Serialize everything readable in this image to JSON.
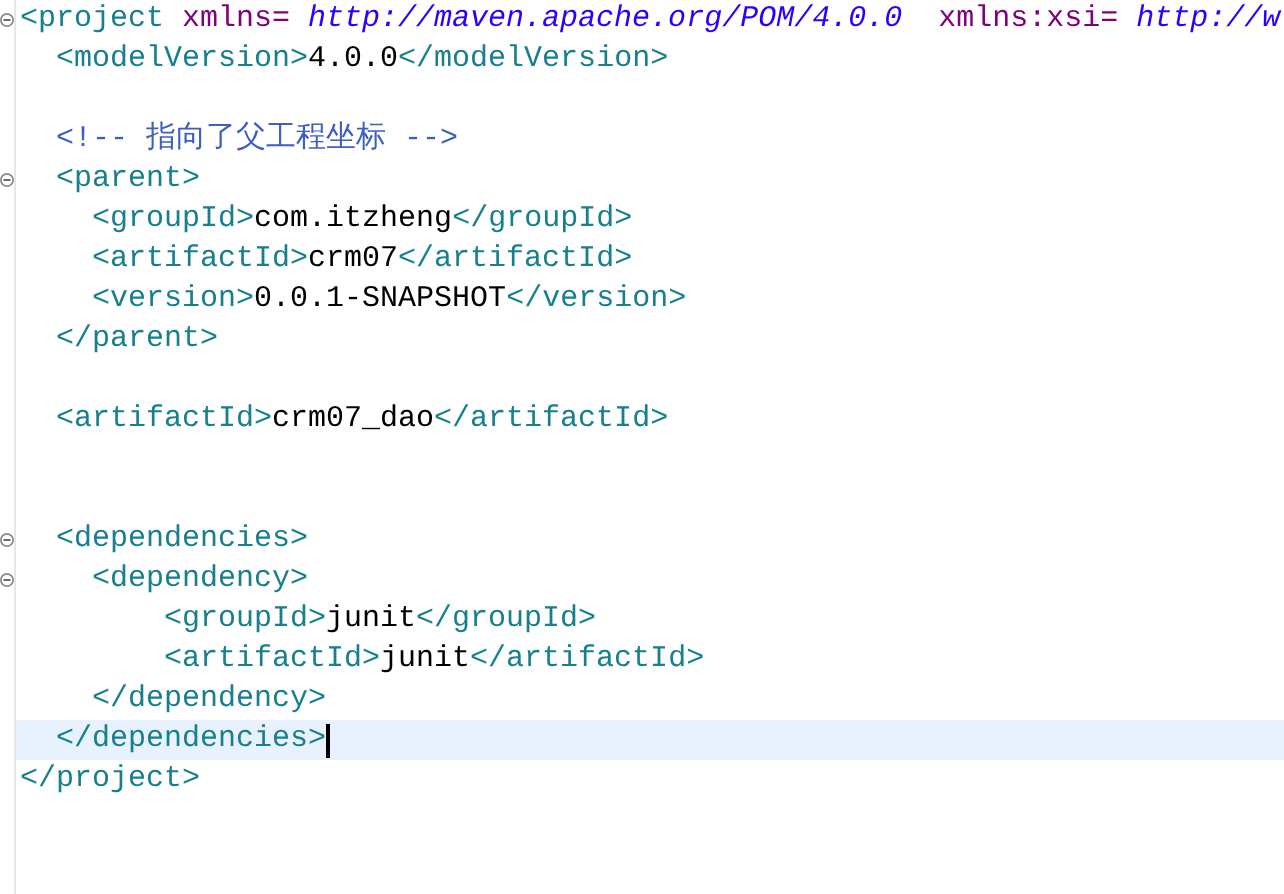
{
  "editor": {
    "lines": [
      {
        "fold": true,
        "current": false,
        "segments": [
          {
            "kind": "tag",
            "text": "<project"
          },
          {
            "kind": "attr",
            "text": " xmlns="
          },
          {
            "kind": "value",
            "text": " http://maven.apache.org/POM/4.0.0"
          },
          {
            "kind": "attr",
            "text": "  xmlns:xsi="
          },
          {
            "kind": "value",
            "text": " http://w"
          }
        ]
      },
      {
        "fold": false,
        "current": false,
        "segments": [
          {
            "kind": "tag",
            "text": "  <modelVersion>"
          },
          {
            "kind": "text",
            "text": "4.0.0"
          },
          {
            "kind": "tag",
            "text": "</modelVersion>"
          }
        ]
      },
      {
        "fold": false,
        "current": false
      },
      {
        "fold": false,
        "current": false,
        "segments": [
          {
            "kind": "comment",
            "text": "  <!-- 指向了父工程坐标 -->"
          }
        ]
      },
      {
        "fold": true,
        "current": false,
        "segments": [
          {
            "kind": "tag",
            "text": "  <parent>"
          }
        ]
      },
      {
        "fold": false,
        "current": false,
        "segments": [
          {
            "kind": "tag",
            "text": "    <groupId>"
          },
          {
            "kind": "text",
            "text": "com.itzheng"
          },
          {
            "kind": "tag",
            "text": "</groupId>"
          }
        ]
      },
      {
        "fold": false,
        "current": false,
        "segments": [
          {
            "kind": "tag",
            "text": "    <artifactId>"
          },
          {
            "kind": "text",
            "text": "crm07"
          },
          {
            "kind": "tag",
            "text": "</artifactId>"
          }
        ]
      },
      {
        "fold": false,
        "current": false,
        "segments": [
          {
            "kind": "tag",
            "text": "    <version>"
          },
          {
            "kind": "text",
            "text": "0.0.1-SNAPSHOT"
          },
          {
            "kind": "tag",
            "text": "</version>"
          }
        ]
      },
      {
        "fold": false,
        "current": false,
        "segments": [
          {
            "kind": "tag",
            "text": "  </parent>"
          }
        ]
      },
      {
        "fold": false,
        "current": false
      },
      {
        "fold": false,
        "current": false,
        "segments": [
          {
            "kind": "tag",
            "text": "  <artifactId>"
          },
          {
            "kind": "text",
            "text": "crm07_dao"
          },
          {
            "kind": "tag",
            "text": "</artifactId>"
          }
        ]
      },
      {
        "fold": false,
        "current": false
      },
      {
        "fold": false,
        "current": false
      },
      {
        "fold": true,
        "current": false,
        "segments": [
          {
            "kind": "tag",
            "text": "  <dependencies>"
          }
        ]
      },
      {
        "fold": true,
        "current": false,
        "segments": [
          {
            "kind": "tag",
            "text": "    <dependency>"
          }
        ]
      },
      {
        "fold": false,
        "current": false,
        "segments": [
          {
            "kind": "tag",
            "text": "        <groupId>"
          },
          {
            "kind": "text",
            "text": "junit"
          },
          {
            "kind": "tag",
            "text": "</groupId>"
          }
        ]
      },
      {
        "fold": false,
        "current": false,
        "segments": [
          {
            "kind": "tag",
            "text": "        <artifactId>"
          },
          {
            "kind": "text",
            "text": "junit"
          },
          {
            "kind": "tag",
            "text": "</artifactId>"
          }
        ]
      },
      {
        "fold": false,
        "current": false,
        "segments": [
          {
            "kind": "tag",
            "text": "    </dependency>"
          }
        ]
      },
      {
        "fold": false,
        "current": true,
        "segments": [
          {
            "kind": "tag",
            "text": "  </dependencies>"
          }
        ]
      },
      {
        "fold": false,
        "current": false,
        "segments": [
          {
            "kind": "tag",
            "text": "</project>"
          }
        ]
      }
    ]
  }
}
